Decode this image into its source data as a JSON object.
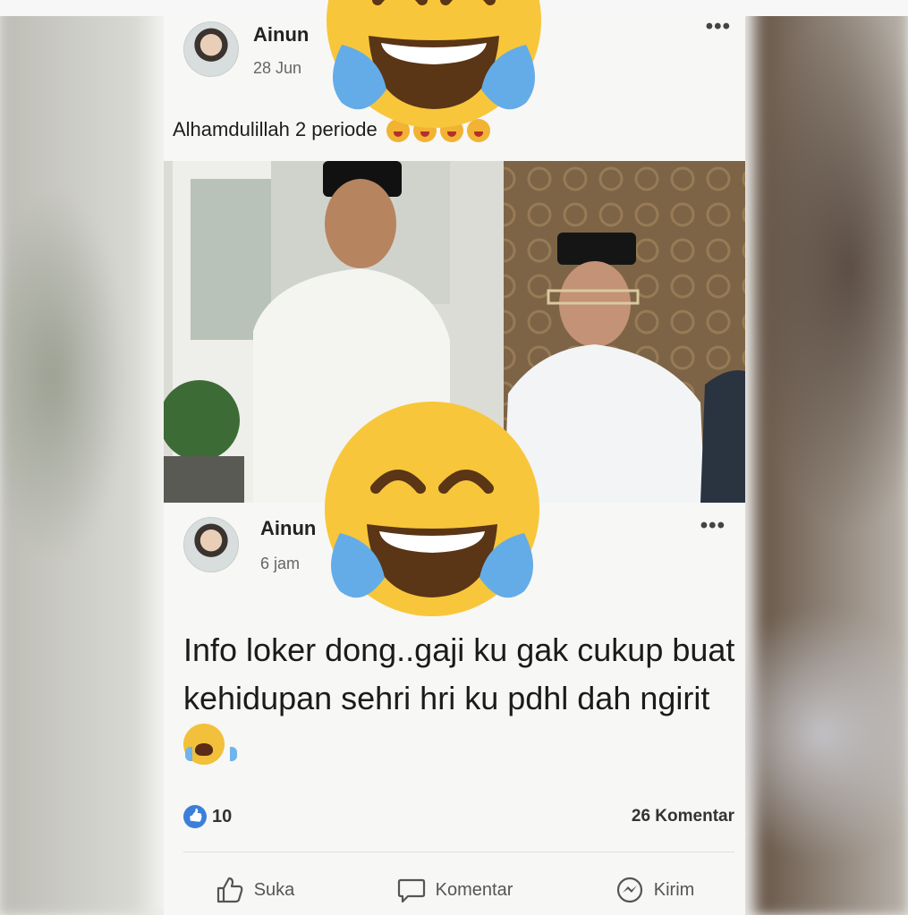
{
  "post1": {
    "author": "Ainun",
    "timestamp": "28 Jun",
    "caption": "Alhamdulillah 2 periode",
    "menu_icon": "more-dots-icon"
  },
  "post2": {
    "author": "Ainun",
    "timestamp": "6 jam",
    "text": "Info loker dong..gaji ku gak cukup buat kehidupan sehri hri ku pdhl dah ngirit",
    "likes": "10",
    "comments": "26 Komentar",
    "actions": {
      "like": "Suka",
      "comment": "Komentar",
      "send": "Kirim"
    }
  },
  "colors": {
    "like_badge": "#3b7fd9",
    "emoji_yellow": "#f8c63a",
    "tear_blue": "#6fb4ec"
  },
  "overlay_icons": [
    "laughing-tears-emoji-icon",
    "laughing-tears-emoji-icon"
  ]
}
